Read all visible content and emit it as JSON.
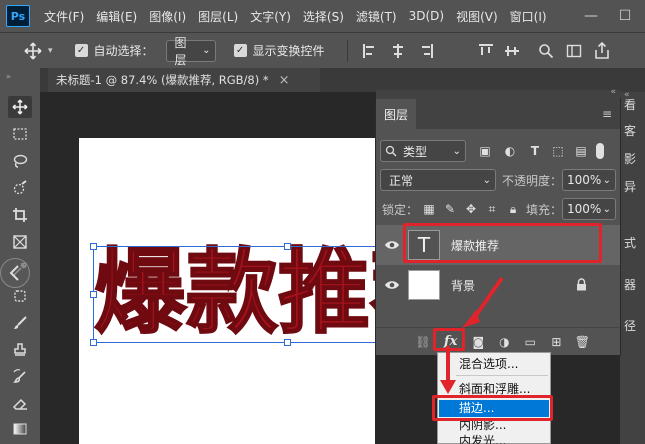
{
  "app": {
    "logo": "Ps"
  },
  "menubar": {
    "items": [
      "文件(F)",
      "编辑(E)",
      "图像(I)",
      "图层(L)",
      "文字(Y)",
      "选择(S)",
      "滤镜(T)",
      "3D(D)",
      "视图(V)",
      "窗口(I)"
    ],
    "minimize": "—",
    "maximize": "☐"
  },
  "options_bar": {
    "auto_select_label": "自动选择：",
    "auto_select_value": "图层",
    "show_transform_label": "显示变换控件"
  },
  "document": {
    "tab_title": "未标题-1 @ 87.4% (爆款推荐, RGB/8) *",
    "close": "×",
    "canvas_text": "爆款推荐"
  },
  "layers_panel": {
    "title": "图层",
    "filter_kind": "类型",
    "blend_mode": "正常",
    "opacity_label": "不透明度：",
    "opacity_value": "100%",
    "lock_label": "锁定：",
    "fill_label": "填充：",
    "fill_value": "100%",
    "layers": [
      {
        "name": "爆款推荐",
        "type": "text",
        "thumb_glyph": "T",
        "selected": true
      },
      {
        "name": "背景",
        "type": "background",
        "locked": true,
        "selected": false
      }
    ],
    "fx_label": "fx"
  },
  "context_menu": {
    "items": [
      "混合选项...",
      "斜面和浮雕...",
      "描边...",
      "内阴影...",
      "内发光..."
    ],
    "highlighted": "描边..."
  },
  "right_strip": {
    "chars": [
      "看",
      "客",
      "影",
      "异",
      "式",
      "器",
      "径"
    ]
  },
  "colors": {
    "accent_red": "#e0242c",
    "canvas_text": "#a3121c",
    "selection": "#0078d7",
    "panel_bg": "#535353"
  },
  "icons": {
    "move": "move-icon",
    "eye": "eye-icon",
    "lock": "lock-icon",
    "fx": "fx-icon"
  }
}
